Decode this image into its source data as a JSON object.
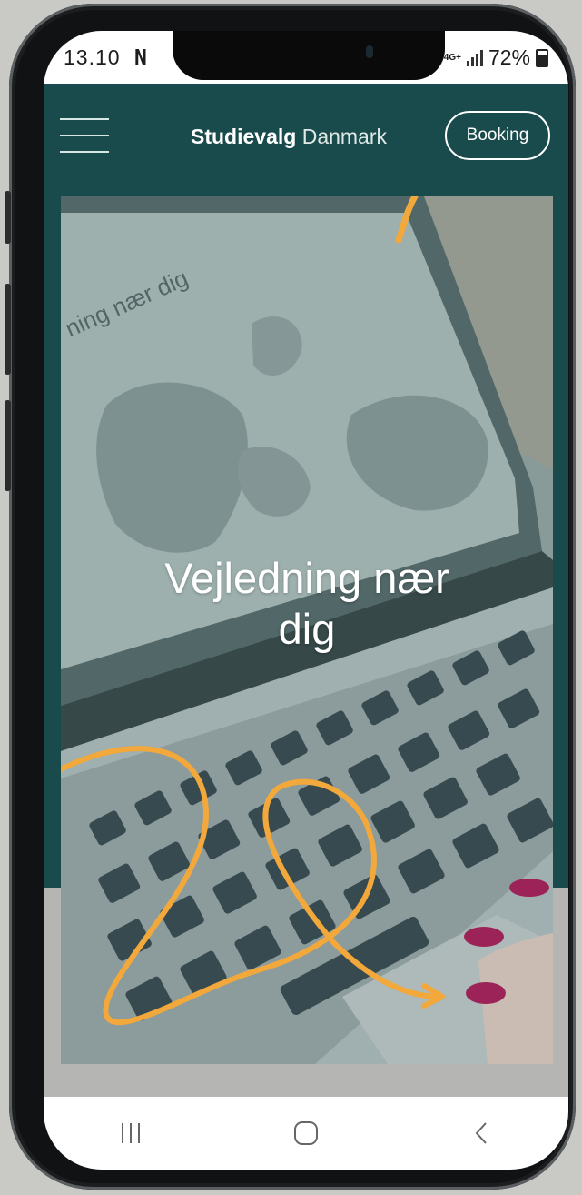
{
  "status_bar": {
    "time": "13.10",
    "notification_icon": "n-icon",
    "network": "4G+",
    "battery": "72%"
  },
  "header": {
    "brand_bold": "Studievalg",
    "brand_light": " Danmark",
    "booking_label": "Booking"
  },
  "hero": {
    "title_line1": "Vejledning nær",
    "title_line2": "dig",
    "image_text": "ning nær dig"
  },
  "colors": {
    "header_bg": "#1a4b4c",
    "accent_yellow": "#f2a83a",
    "nav_bg": "#ffffff"
  },
  "nav": {
    "recent_icon": "recent-apps-icon",
    "home_icon": "home-icon",
    "back_icon": "back-icon"
  }
}
